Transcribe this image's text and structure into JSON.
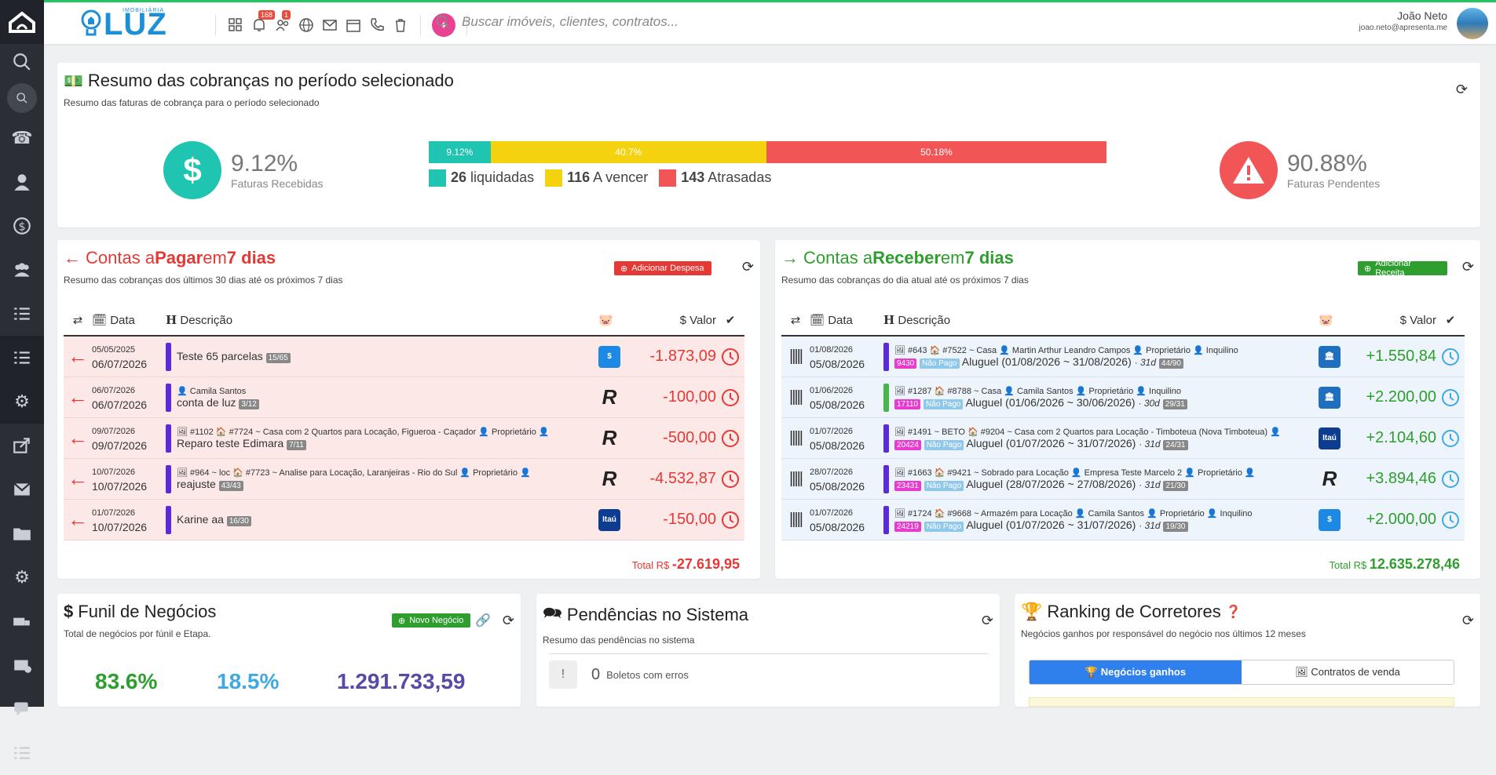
{
  "app": {
    "logo": "LUZ",
    "logo_sub": "IMOBILIÁRIA",
    "notif_count": "168",
    "user_count": "1",
    "search_placeholder": "Buscar imóveis, clientes, contratos...",
    "user_name": "João Neto",
    "user_email": "joao.neto@apresenta.me"
  },
  "summary": {
    "title": "Resumo das cobranças no período selecionado",
    "subtitle": "Resumo das faturas de cobrança para o período selecionado",
    "received_pct": "9.12%",
    "received_label": "Faturas Recebidas",
    "pending_pct": "90.88%",
    "pending_label": "Faturas Pendentes",
    "bar": [
      {
        "label": "9.12%",
        "value": 9.12,
        "color": "#20c5b1"
      },
      {
        "label": "40.7%",
        "value": 40.7,
        "color": "#f5d20f"
      },
      {
        "label": "50.18%",
        "value": 50.18,
        "color": "#f25555"
      }
    ],
    "legend": [
      {
        "count": "26",
        "label": "liquidadas",
        "color": "#20c5b1"
      },
      {
        "count": "116",
        "label": "A vencer",
        "color": "#f5d20f"
      },
      {
        "count": "143",
        "label": "Atrasadas",
        "color": "#f25555"
      }
    ]
  },
  "pay": {
    "t1": "Contas a ",
    "t2": "Pagar",
    "t3": " em ",
    "t4": "7 dias",
    "subtitle": "Resumo das cobranças dos últimos 30 dias até os próximos 7 dias",
    "button": "Adicionar Despesa",
    "col_date": "Data",
    "col_desc": "Descrição",
    "col_value": "Valor",
    "total_label": "Total R$",
    "total": "-27.619,95",
    "rows": [
      {
        "d1": "05/05/2025",
        "d2": "06/07/2026",
        "meta": "",
        "desc": "Teste 65 parcelas",
        "tag": "15/65",
        "bank": "$",
        "bank_color": "#1e88e5",
        "value": "-1.873,09"
      },
      {
        "d1": "06/07/2026",
        "d2": "06/07/2026",
        "meta": "👤 Camila Santos",
        "desc": "conta de luz",
        "tag": "3/12",
        "bank": "R",
        "bank_color": "#222",
        "value": "-100,00"
      },
      {
        "d1": "09/07/2026",
        "d2": "09/07/2026",
        "meta": "🖼 #1102  🏠 #7724 ~ Casa com 2 Quartos para Locação, Figueroa - Caçador  👤 Proprietário  👤",
        "desc": "Reparo teste Edimara",
        "tag": "7/11",
        "bank": "R",
        "bank_color": "#222",
        "value": "-500,00"
      },
      {
        "d1": "10/07/2026",
        "d2": "10/07/2026",
        "meta": "🖼 #964 ~ loc  🏠 #7723 ~ Analise para Locação, Laranjeiras - Rio do Sul  👤 Proprietário  👤",
        "desc": "reajuste",
        "tag": "43/43",
        "bank": "R",
        "bank_color": "#222",
        "value": "-4.532,87"
      },
      {
        "d1": "01/07/2026",
        "d2": "10/07/2026",
        "meta": "",
        "desc": "Karine aa",
        "tag": "16/30",
        "bank": "Itaú",
        "bank_color": "#0d3c91",
        "value": "-150,00"
      }
    ]
  },
  "rec": {
    "t1": "Contas a ",
    "t2": "Receber",
    "t3": " em ",
    "t4": "7 dias",
    "subtitle": "Resumo das cobranças do dia atual até os próximos 7 dias",
    "button": "Adicionar Receita",
    "col_date": "Data",
    "col_desc": "Descrição",
    "col_value": "Valor",
    "total_label": "Total R$",
    "total": "12.635.278,46",
    "rows": [
      {
        "d1": "01/08/2026",
        "d2": "05/08/2026",
        "meta": "🖼 #643  🏠 #7522 ~ Casa  👤 Martin Arthur Leandro Campos  👤 Proprietário  👤 Inquilino",
        "code": "9430",
        "status": "Não Pago",
        "desc": "Aluguel (01/08/2026 ~ 31/08/2026)",
        "days": "· 31d",
        "tag": "44/90",
        "bank": "🏛",
        "bank_color": "#1e6fc0",
        "value": "+1.550,84",
        "bar": "#5b2bd9"
      },
      {
        "d1": "01/06/2026",
        "d2": "05/08/2026",
        "meta": "🖼 #1287  🏠 #8788 ~ Casa  👤 Camila Santos  👤 Proprietário  👤 Inquilino",
        "code": "17110",
        "status": "Não Pago",
        "desc": "Aluguel (01/06/2026 ~ 30/06/2026)",
        "days": "· 30d",
        "tag": "29/31",
        "bank": "🏛",
        "bank_color": "#1e6fc0",
        "value": "+2.200,00",
        "bar": "#45b649"
      },
      {
        "d1": "01/07/2026",
        "d2": "05/08/2026",
        "meta": "🖼 #1491 ~ BETO  🏠 #9204 ~ Casa com 2 Quartos para Locação - Timboteua (Nova Timboteua)  👤",
        "code": "20424",
        "status": "Não Pago",
        "desc": "Aluguel (01/07/2026 ~ 31/07/2026)",
        "days": "· 31d",
        "tag": "24/31",
        "bank": "Itaú",
        "bank_color": "#0d3c91",
        "value": "+2.104,60",
        "bar": "#5b2bd9"
      },
      {
        "d1": "28/07/2026",
        "d2": "05/08/2026",
        "meta": "🖼 #1663  🏠 #9421 ~ Sobrado para Locação  👤 Empresa Teste Marcelo 2  👤 Proprietário  👤",
        "code": "23431",
        "status": "Não Pago",
        "desc": "Aluguel (28/07/2026 ~ 27/08/2026)",
        "days": "· 31d",
        "tag": "21/30",
        "bank": "R",
        "bank_color": "#222",
        "value": "+3.894,46",
        "bar": "#5b2bd9"
      },
      {
        "d1": "01/07/2026",
        "d2": "05/08/2026",
        "meta": "🖼 #1724  🏠 #9668 ~ Armazém para Locação  👤 Camila Santos  👤 Proprietário  👤 Inquilino",
        "code": "24219",
        "status": "Não Pago",
        "desc": "Aluguel (01/07/2026 ~ 31/07/2026)",
        "days": "· 31d",
        "tag": "19/30",
        "bank": "$",
        "bank_color": "#1e88e5",
        "value": "+2.000,00",
        "bar": "#5b2bd9"
      }
    ]
  },
  "funil": {
    "title": "Funil de Negócios",
    "subtitle": "Total de negócios por fúnil e Etapa.",
    "button": "Novo Negócio",
    "v1": "83.6%",
    "v2": "18.5%",
    "v3": "1.291.733,59"
  },
  "pend": {
    "title": "Pendências no Sistema",
    "subtitle": "Resumo das pendências no sistema",
    "count": "0",
    "label": "Boletos com erros"
  },
  "rank": {
    "title": "Ranking de Corretores",
    "subtitle": "Negócios ganhos por responsável do negócio nos últimos 12 meses",
    "tab1": "Negócios ganhos",
    "tab2": "Contratos de venda"
  },
  "colors": {
    "accent_green": "#22c55e",
    "teal": "#20c5b1",
    "red": "#f25555",
    "blue": "#2f80ed"
  }
}
